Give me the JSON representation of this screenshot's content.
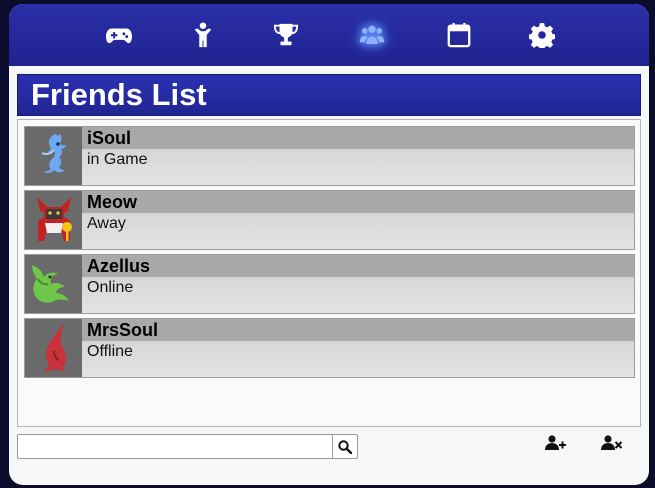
{
  "nav": {
    "items": [
      {
        "icon": "gamepad-icon"
      },
      {
        "icon": "person-icon"
      },
      {
        "icon": "trophy-icon"
      },
      {
        "icon": "friends-icon",
        "active": true
      },
      {
        "icon": "calendar-icon"
      },
      {
        "icon": "gear-icon"
      }
    ]
  },
  "panel": {
    "title": "Friends List"
  },
  "friends": [
    {
      "name": "iSoul",
      "status": "in Game",
      "avatar": "blue-creature-avatar"
    },
    {
      "name": "Meow",
      "status": "Away",
      "avatar": "red-creature-avatar"
    },
    {
      "name": "Azellus",
      "status": "Online",
      "avatar": "green-creature-avatar"
    },
    {
      "name": "MrsSoul",
      "status": "Offline",
      "avatar": "red-bulb-avatar"
    }
  ],
  "search": {
    "value": "",
    "placeholder": "",
    "icon": "search-icon"
  },
  "actions": {
    "add_icon": "add-friend-icon",
    "remove_icon": "remove-friend-icon"
  },
  "colors": {
    "nav_bg": "#2326a0",
    "title_bg": "#2329a0",
    "active_glow": "#5a8cff"
  }
}
